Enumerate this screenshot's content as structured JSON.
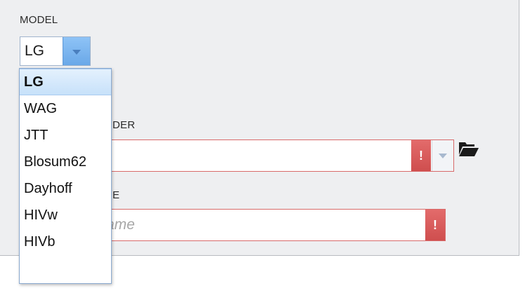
{
  "model": {
    "label": "MODEL",
    "selected_value": "LG",
    "options": [
      "LG",
      "WAG",
      "JTT",
      "Blosum62",
      "Dayhoff",
      "HIVw",
      "HIVb"
    ]
  },
  "folder_section": {
    "label_visible_part": "DER"
  },
  "name_section": {
    "label_visible_part": "E",
    "placeholder_visible_part": "ame"
  },
  "error_badge_text": "!",
  "icons": {
    "combo_caret": "chevron-down-icon",
    "error": "error-icon",
    "folder": "folder-open-icon"
  },
  "colors": {
    "panel_bg": "#eeeff1",
    "accent_blue": "#6aa8e8",
    "error_red": "#d86a6a",
    "selected_item": "#c7e1fa"
  }
}
